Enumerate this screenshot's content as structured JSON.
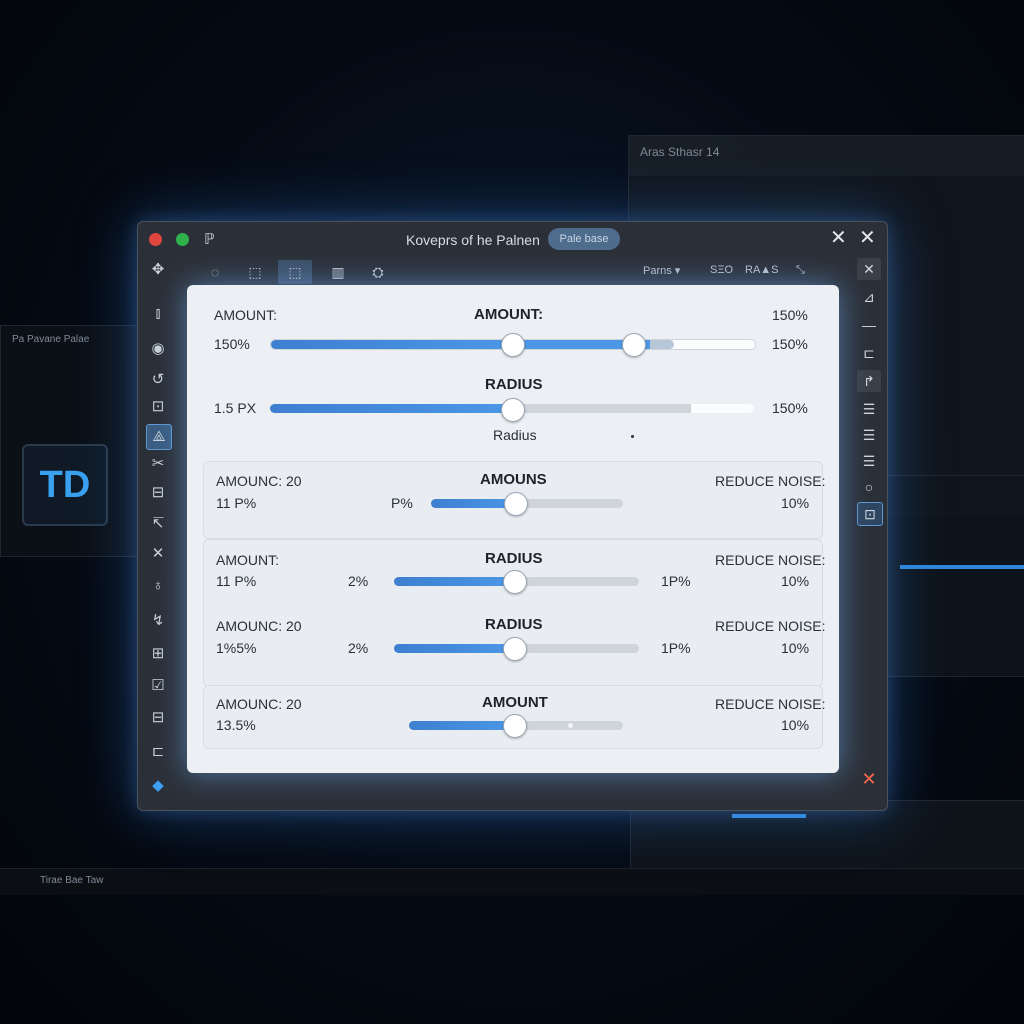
{
  "window": {
    "title": "Koveprs of he Palnen",
    "badge": "Pale base",
    "app_icon": "ℙ",
    "close_glyph_1": "✕",
    "close_glyph_2": "✕"
  },
  "toolbar": {
    "tools": [
      "◌",
      "⬚",
      "⬚",
      "▥",
      "⛭"
    ],
    "right_label_1": "Parns ▾",
    "right_label_2": "ЅΞO",
    "right_label_3": "RA▲S",
    "right_icon": "⤡"
  },
  "left_tools": [
    "✥",
    "⫾",
    "◉",
    "↺",
    "⊡",
    "⟁",
    "✂",
    "⊟",
    "↸",
    "✕",
    "♁",
    "↯",
    "⊞",
    "☑",
    "⊟",
    "⊏",
    "◆"
  ],
  "right_tools": [
    "✕",
    "⊿",
    "—",
    "⊏",
    "↱",
    "☰",
    "☰",
    "☰",
    "○",
    "⊡",
    "✕"
  ],
  "panel": {
    "row1": {
      "left_label": "AMOUNT:",
      "center_label": "AMOUNT:",
      "right_label": "150%",
      "left_value": "150%",
      "right_value": "150%",
      "fill": 0.5,
      "knob2": 0.75
    },
    "row2": {
      "center_label": "RADIUS",
      "left_value": "1.5 PX",
      "right_value": "150%",
      "sub_label": "Radius",
      "fill": 0.5,
      "white_from": 0.87
    },
    "group1": {
      "left_label": "AMOUNC: 20",
      "left_value": "11 P%",
      "mid_value": "P%",
      "center_label": "AMOUNS",
      "right_label": "REDUCE NOISE:",
      "right_value": "10%",
      "fill": 0.44
    },
    "group2a": {
      "left_label": "AMOUNT:",
      "left_value": "11 P%",
      "mid_value": "2%",
      "center_label": "RADIUS",
      "right_mid_value": "1P%",
      "right_label": "REDUCE NOISE:",
      "right_value": "10%",
      "fill": 0.49
    },
    "group2b": {
      "left_label": "AMOUNC: 20",
      "left_value": "1%5%",
      "mid_value": "2%",
      "center_label": "RADIUS",
      "right_mid_value": "1P%",
      "right_label": "REDUCE NOISE:",
      "right_value": "10%",
      "fill": 0.49
    },
    "group3": {
      "left_label": "AMOUNC: 20",
      "left_value": "13.5%",
      "center_label": "AMOUNT",
      "right_label": "REDUCE NOISE:",
      "right_value": "10%",
      "fill": 0.49
    }
  },
  "background": {
    "window_title": "Aras Sthasr 14",
    "left_text": "Pa Pavane Palae",
    "logo": "TD",
    "taskbar_text": "Tirae Bae Taw"
  }
}
